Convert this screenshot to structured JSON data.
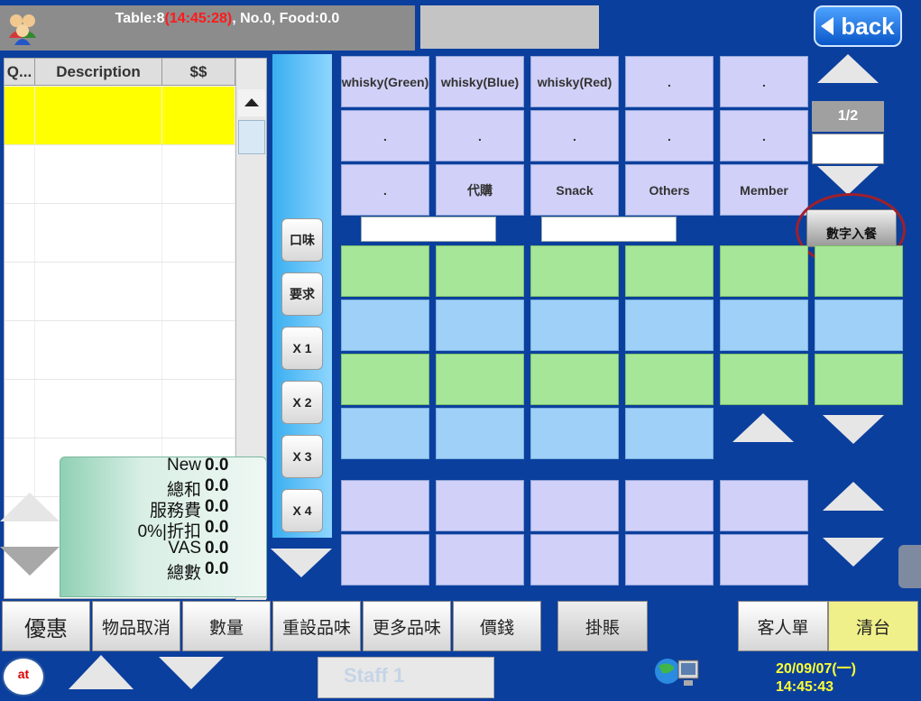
{
  "header": {
    "title_prefix": "Table:8",
    "title_time": "(14:45:28)",
    "title_suffix": ", No.0, Food:0.0",
    "back_label": "back"
  },
  "order_table": {
    "columns": [
      "Q...",
      "Description",
      "$$"
    ]
  },
  "summary": {
    "lines": [
      {
        "label": "New",
        "value": "0.0"
      },
      {
        "label": "總和",
        "value": "0.0"
      },
      {
        "label": "服務費",
        "value": "0.0"
      },
      {
        "label": "0%|折扣",
        "value": "0.0"
      },
      {
        "label": "VAS",
        "value": "0.0"
      },
      {
        "label": "總數",
        "value": "0.0"
      }
    ]
  },
  "modifiers": [
    "口味",
    "要求",
    "X 1",
    "X 2",
    "X 3",
    "X 4"
  ],
  "categories": {
    "row1": [
      "whisky(Green)",
      "whisky(Blue)",
      "whisky(Red)",
      ".",
      "."
    ],
    "row2": [
      ".",
      ".",
      ".",
      ".",
      "."
    ],
    "row3": [
      ".",
      "代購",
      "Snack",
      "Others",
      "Member"
    ]
  },
  "pager": {
    "label": "1/2",
    "numeric_entry": "數字入餐"
  },
  "bottom_bar": {
    "buttons": [
      "優惠",
      "物品取消",
      "數量",
      "重設品味",
      "更多品味",
      "價錢"
    ],
    "hold": "掛賬",
    "customer_bill": "客人單",
    "clear_table": "清台",
    "staff": "Staff 1",
    "date": "20/09/07(一)",
    "time": "14:45:43",
    "logo": "at"
  },
  "colors": {
    "background": "#0b3f9e",
    "selected_row": "#ffff00",
    "category": "#d0d0f8",
    "item_green": "#a6e698",
    "item_blue": "#9fd0f8",
    "time_red": "#ff1a1a",
    "date_yellow": "#ffff33"
  }
}
